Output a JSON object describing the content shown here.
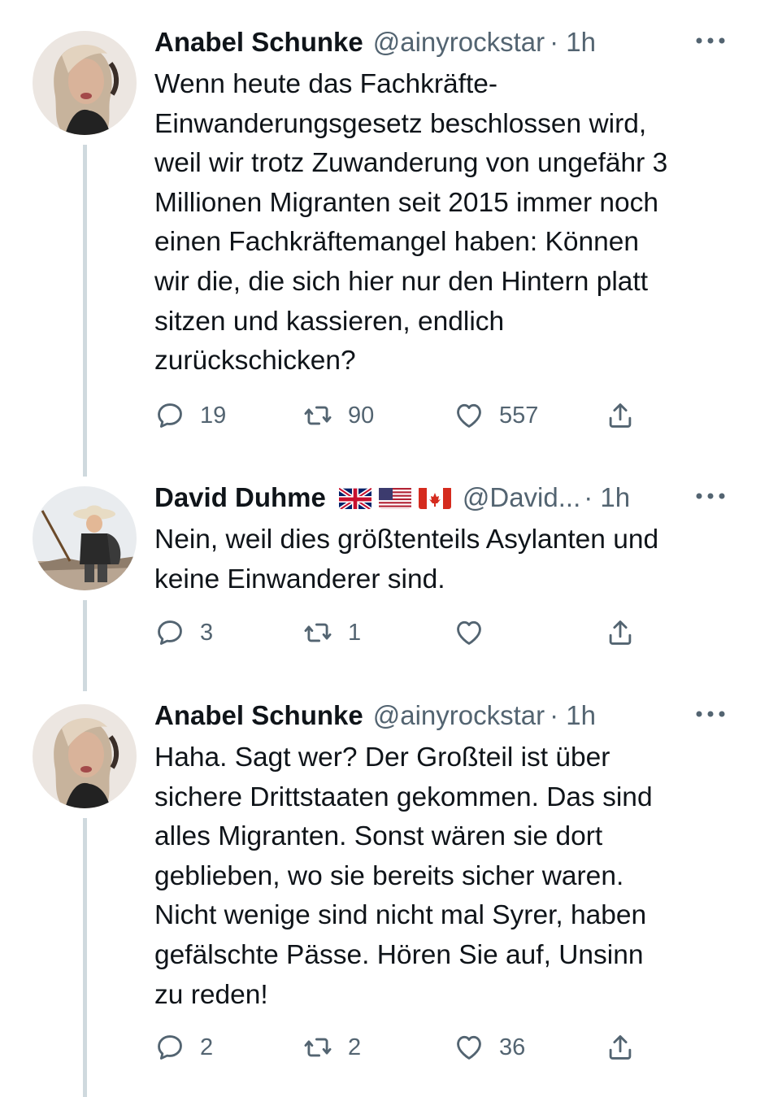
{
  "tweets": [
    {
      "name": "Anabel Schunke",
      "handle": "@ainyrockstar",
      "time": "· 1h",
      "lines": [
        "Wenn heute das Fachkräfte-",
        "Einwanderungsgesetz beschlossen wird,",
        "weil wir trotz Zuwanderung von ungefähr 3",
        "Millionen Migranten seit 2015 immer noch",
        "einen Fachkräftemangel haben: Können",
        "wir die, die sich hier nur den Hintern platt",
        "sitzen und kassieren, endlich",
        "zurückschicken?"
      ],
      "replies": "19",
      "retweets": "90",
      "likes": "557"
    },
    {
      "name": "David Duhme",
      "handle": "@David...",
      "time": "· 1h",
      "lines": [
        "Nein, weil dies größtenteils Asylanten und",
        "keine Einwanderer sind."
      ],
      "replies": "3",
      "retweets": "1",
      "likes": ""
    },
    {
      "name": "Anabel Schunke",
      "handle": "@ainyrockstar",
      "time": "· 1h",
      "lines": [
        "Haha. Sagt wer? Der Großteil ist über",
        "sichere Drittstaaten gekommen. Das sind",
        "alles Migranten. Sonst wären sie dort",
        "geblieben, wo sie bereits sicher waren.",
        "Nicht wenige sind nicht mal Syrer, haben",
        "gefälschte Pässe. Hören Sie auf, Unsinn",
        "zu reden!"
      ],
      "replies": "2",
      "retweets": "2",
      "likes": "36"
    }
  ],
  "icons": {
    "reply": "reply-icon",
    "retweet": "retweet-icon",
    "like": "heart-icon",
    "share": "share-icon",
    "more": "more-icon"
  },
  "flags": [
    "uk-flag",
    "us-flag",
    "canada-flag"
  ],
  "colors": {
    "text": "#0f1419",
    "secondary": "#536471",
    "thread_line": "#cfd9de",
    "background": "#ffffff"
  }
}
